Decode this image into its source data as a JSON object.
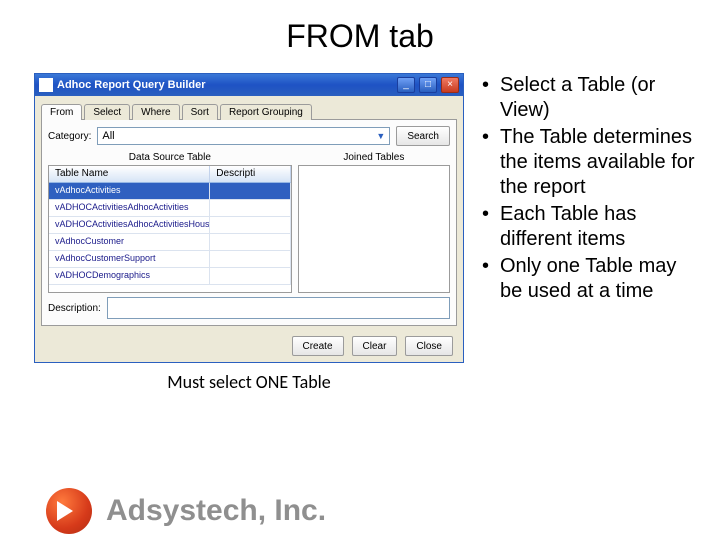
{
  "slide": {
    "title": "FROM tab"
  },
  "window": {
    "title": "Adhoc Report Query Builder",
    "tabs": [
      "From",
      "Select",
      "Where",
      "Sort",
      "Report Grouping"
    ],
    "active_tab": 0,
    "category_label": "Category:",
    "category_value": "All",
    "search_label": "Search",
    "left_header": "Data Source Table",
    "right_header": "Joined Tables",
    "grid_cols": [
      "Table Name",
      "Descripti"
    ],
    "grid_rows": [
      "vAdhocActivities",
      "vADHOCActivitiesAdhocActivities",
      "vADHOCActivitiesAdhocActivitiesHouseh",
      "vAdhocCustomer",
      "vAdhocCustomerSupport",
      "vADHOCDemographics"
    ],
    "selected_row": 0,
    "desc_label": "Description:",
    "buttons": [
      "Create",
      "Clear",
      "Close"
    ]
  },
  "caption": "Must select ONE Table",
  "bullets": [
    "Select a Table (or View)",
    "The Table determines the items available for the report",
    "Each Table has different items",
    "Only one Table may be used at a time"
  ],
  "footer": {
    "company": "Adsystech, Inc."
  }
}
